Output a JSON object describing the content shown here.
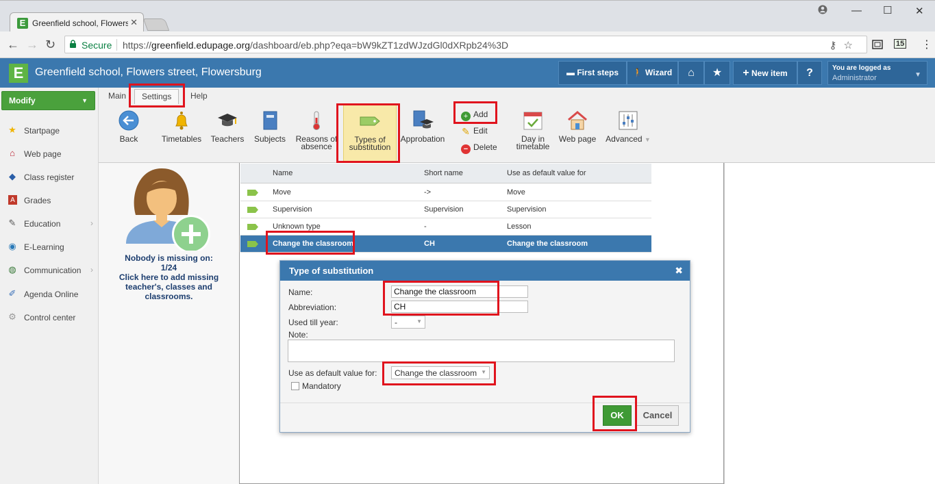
{
  "browser": {
    "tab_title": "Greenfield school, Flowers street, Flowersburg",
    "secure_label": "Secure",
    "url_scheme": "https://",
    "url_host": "greenfield.edupage.org",
    "url_path": "/dashboard/eb.php?eqa=bW9kZT1zdWJzdGl0dXRpb24%3D",
    "ext_badge": "15"
  },
  "header": {
    "title": "Greenfield school, Flowers street, Flowersburg",
    "first_steps": "First steps",
    "wizard": "Wizard",
    "new_item": "New item",
    "help": "?",
    "login_line1": "You are logged as",
    "login_line2": "Administrator"
  },
  "sidebar": {
    "modify_label": "Modify",
    "items": [
      {
        "label": "Startpage",
        "icon": "star-icon"
      },
      {
        "label": "Web page",
        "icon": "webpage-icon"
      },
      {
        "label": "Class register",
        "icon": "class-register-icon"
      },
      {
        "label": "Grades",
        "icon": "grades-icon"
      },
      {
        "label": "Education",
        "icon": "education-icon"
      },
      {
        "label": "E-Learning",
        "icon": "elearning-icon"
      },
      {
        "label": "Communication",
        "icon": "communication-icon"
      },
      {
        "label": "Agenda Online",
        "icon": "agenda-icon"
      },
      {
        "label": "Control center",
        "icon": "control-center-icon"
      }
    ]
  },
  "ribbon": {
    "tabs": [
      "Main",
      "Settings",
      "Help"
    ],
    "back": "Back",
    "timetables": "Timetables",
    "teachers": "Teachers",
    "subjects": "Subjects",
    "reasons_l1": "Reasons of",
    "reasons_l2": "absence",
    "types_l1": "Types of",
    "types_l2": "substitution",
    "approbation": "Approbation",
    "add": "Add",
    "edit": "Edit",
    "delete": "Delete",
    "day_l1": "Day in",
    "day_l2": "timetable",
    "webpage": "Web page",
    "advanced": "Advanced"
  },
  "leftpanel": {
    "line1": "Nobody is missing on:",
    "line2": "1/24",
    "line3": "Click here to add missing",
    "line4": "teacher's, classes and",
    "line5": "classrooms."
  },
  "table": {
    "headers": [
      "Name",
      "Short name",
      "Use as default value for"
    ],
    "rows": [
      {
        "name": "Move",
        "short": "->",
        "default": "Move"
      },
      {
        "name": "Supervision",
        "short": "Supervision",
        "default": "Supervision"
      },
      {
        "name": "Unknown type",
        "short": "-",
        "default": "Lesson"
      },
      {
        "name": "Change the classroom",
        "short": "CH",
        "default": "Change the classroom"
      }
    ]
  },
  "dialog": {
    "title": "Type of substitution",
    "name_label": "Name:",
    "name_value": "Change the classroom",
    "abbr_label": "Abbreviation:",
    "abbr_value": "CH",
    "used_till_label": "Used till year:",
    "used_till_value": "-",
    "note_label": "Note:",
    "default_label": "Use as default value for:",
    "default_value": "Change the classroom",
    "mandatory_label": "Mandatory",
    "ok": "OK",
    "cancel": "Cancel"
  },
  "colors": {
    "header_blue": "#3b78ae",
    "accent_green": "#4aa13c",
    "highlight_red": "#e0131d"
  }
}
